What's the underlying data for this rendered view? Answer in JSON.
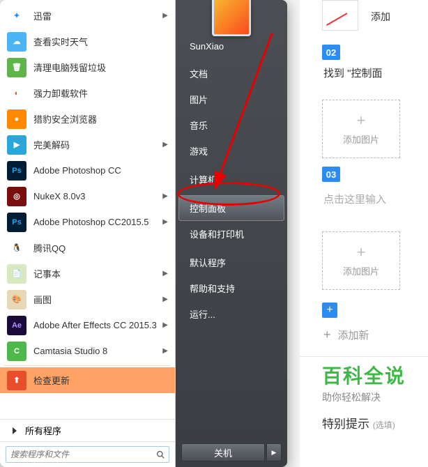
{
  "startmenu": {
    "apps": [
      {
        "label": "迅雷",
        "iconBg": "#ffffff",
        "iconColor": "#1e90ff",
        "glyph": "✦",
        "arrow": true,
        "hl": false
      },
      {
        "label": "查看实时天气",
        "iconBg": "#4ab4f4",
        "glyph": "☁",
        "arrow": false,
        "hl": false
      },
      {
        "label": "清理电脑残留垃圾",
        "iconBg": "#5fb54a",
        "glyph": "🗑",
        "arrow": false,
        "hl": false
      },
      {
        "label": "强力卸载软件",
        "iconBg": "#ffffff",
        "iconColor": "#e05a1a",
        "glyph": "◐",
        "arrow": false,
        "hl": false
      },
      {
        "label": "猎豹安全浏览器",
        "iconBg": "#ff8a00",
        "glyph": "●",
        "arrow": false,
        "hl": false
      },
      {
        "label": "完美解码",
        "iconBg": "#2aa7d8",
        "glyph": "▶",
        "arrow": true,
        "hl": false
      },
      {
        "label": "Adobe Photoshop CC",
        "iconBg": "#001d36",
        "iconColor": "#29a3e8",
        "glyph": "Ps",
        "arrow": false,
        "hl": false
      },
      {
        "label": "NukeX 8.0v3",
        "iconBg": "#7a0d0d",
        "glyph": "◎",
        "arrow": true,
        "hl": false
      },
      {
        "label": "Adobe Photoshop CC2015.5",
        "iconBg": "#001d36",
        "iconColor": "#29a3e8",
        "glyph": "Ps",
        "arrow": true,
        "hl": false
      },
      {
        "label": "腾讯QQ",
        "iconBg": "#ffffff",
        "iconColor": "#111",
        "glyph": "🐧",
        "arrow": false,
        "hl": false
      },
      {
        "label": "记事本",
        "iconBg": "#d7e9c0",
        "iconColor": "#6a8a45",
        "glyph": "📄",
        "arrow": true,
        "hl": false
      },
      {
        "label": "画图",
        "iconBg": "#e8d9b6",
        "iconColor": "#9a5c00",
        "glyph": "🎨",
        "arrow": true,
        "hl": false
      },
      {
        "label": "Adobe After Effects CC 2015.3",
        "iconBg": "#1a0a3a",
        "iconColor": "#b191ff",
        "glyph": "Ae",
        "arrow": true,
        "hl": false
      },
      {
        "label": "Camtasia Studio 8",
        "iconBg": "#4fb84a",
        "glyph": "C",
        "arrow": true,
        "hl": false
      },
      {
        "label": "检查更新",
        "iconBg": "#e84d2c",
        "glyph": "⬆",
        "arrow": false,
        "hl": true
      }
    ],
    "all_programs": "所有程序",
    "search_placeholder": "搜索程序和文件",
    "right_items": [
      {
        "label": "SunXiao",
        "sel": false
      },
      {
        "label": "文档",
        "sel": false
      },
      {
        "label": "图片",
        "sel": false
      },
      {
        "label": "音乐",
        "sel": false
      },
      {
        "label": "游戏",
        "sel": false
      },
      {
        "label": "计算机",
        "sel": false
      },
      {
        "label": "控制面板",
        "sel": true
      },
      {
        "label": "设备和打印机",
        "sel": false
      },
      {
        "label": "默认程序",
        "sel": false
      },
      {
        "label": "帮助和支持",
        "sel": false
      },
      {
        "label": "运行...",
        "sel": false
      }
    ],
    "shutdown": "关机"
  },
  "web": {
    "top_add": "添加",
    "step02": "02",
    "step02_text": "找到 \"控制面",
    "add_image": "添加图片",
    "step03": "03",
    "step03_text": "点击这里输入",
    "add_new": "添加新",
    "baike_title": "百科全说",
    "baike_sub": "助你轻松解决",
    "special": "特别提示",
    "optional": "(选填)"
  }
}
